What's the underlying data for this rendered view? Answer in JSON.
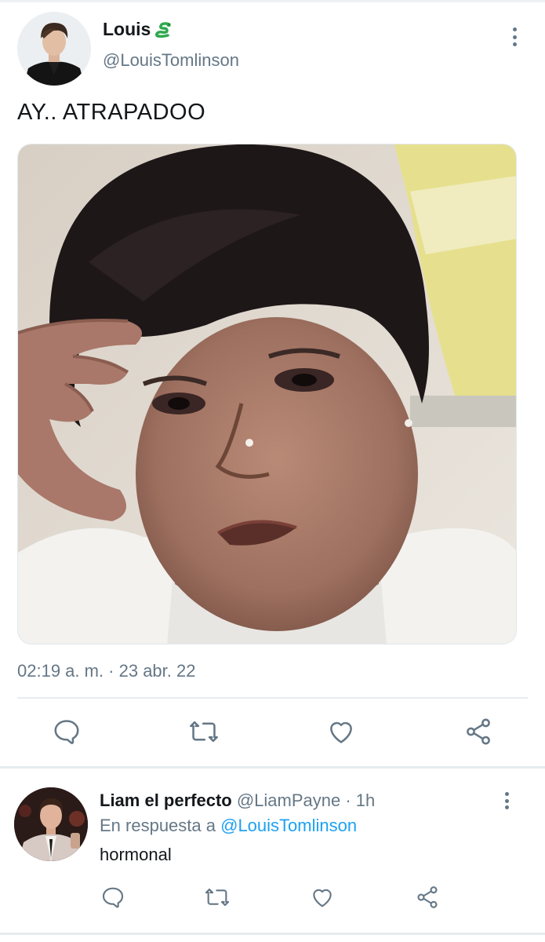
{
  "main_tweet": {
    "author_name": "Louis",
    "author_emoji_icon": "snake-icon",
    "handle": "@LouisTomlinson",
    "text": "AY.. ATRAPADOO",
    "timestamp": "02:19 a. m. · 23 abr. 22",
    "media_alt": "meme photo of a woman touching her forehead looking surprised"
  },
  "reply": {
    "author_name": "Liam el perfecto",
    "handle_time": "@LiamPayne · 1h",
    "reply_prefix": "En respuesta a",
    "reply_to": "@LouisTomlinson",
    "text": "hormonal"
  },
  "actions": {
    "reply_icon": "reply-icon",
    "retweet_icon": "retweet-icon",
    "like_icon": "heart-icon",
    "share_icon": "share-icon"
  },
  "colors": {
    "text_primary": "#14171a",
    "text_secondary": "#657786",
    "link": "#1da1f2",
    "divider": "#e6ecf0",
    "snake_green": "#2fa84f"
  }
}
